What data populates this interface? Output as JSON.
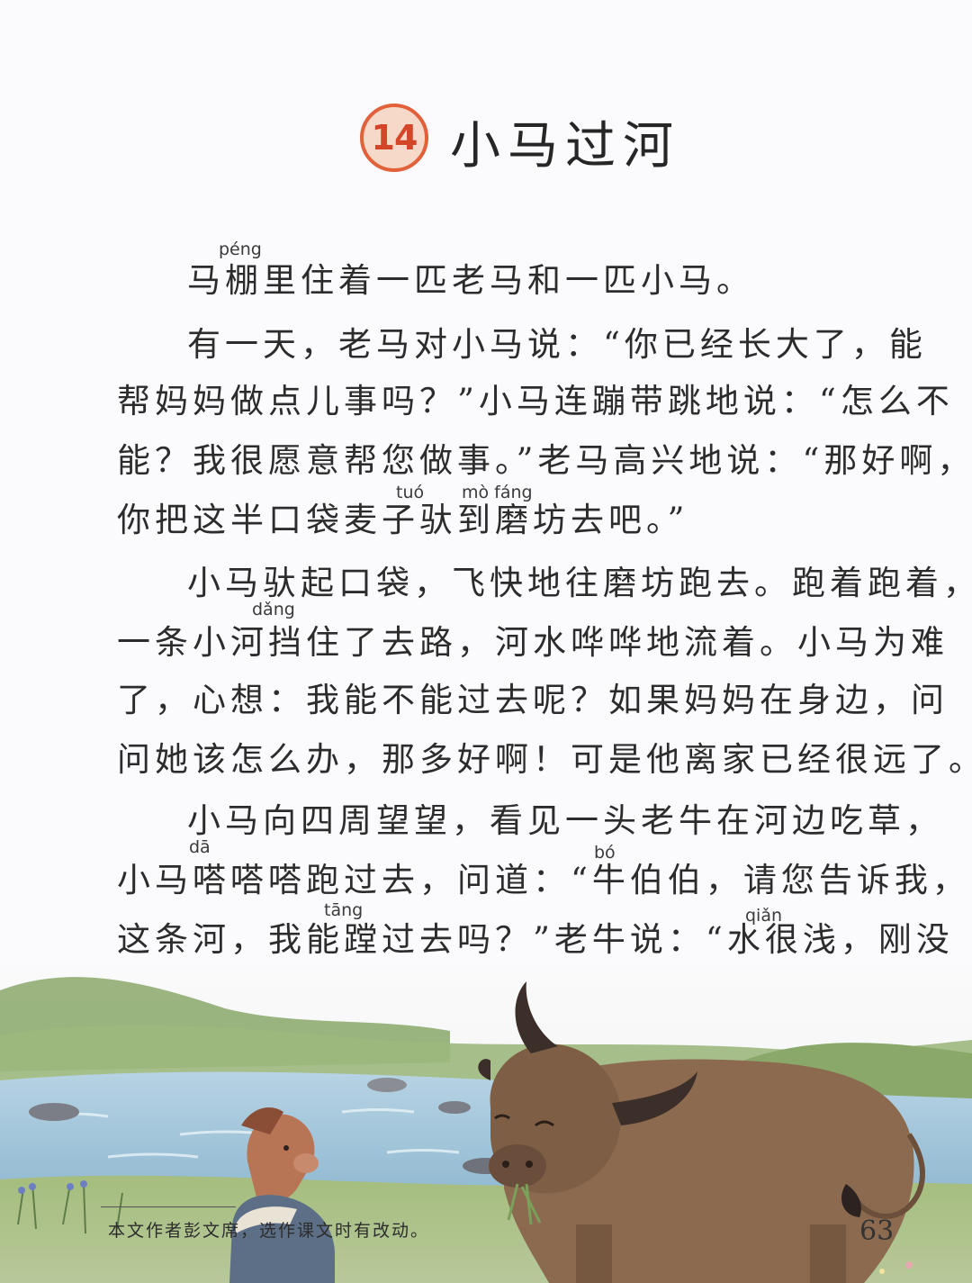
{
  "lesson": {
    "number": "14",
    "title": "小马过河"
  },
  "pinyin": {
    "peng": "péng",
    "tuo": "tuó",
    "mofang": "mò fáng",
    "dang": "dǎng",
    "da": "dā",
    "bo": "bó",
    "tang": "tāng",
    "qian": "qiǎn"
  },
  "paragraphs": {
    "p1_l1": "马棚里住着一匹老马和一匹小马。",
    "p2_l1": "有一天，老马对小马说：“你已经长大了，能",
    "p2_l2": "帮妈妈做点儿事吗？”小马连蹦带跳地说：“怎么不",
    "p2_l3": "能？我很愿意帮您做事。”老马高兴地说：“那好啊，",
    "p2_l4": "你把这半口袋麦子驮到磨坊去吧。”",
    "p3_l1": "小马驮起口袋，飞快地往磨坊跑去。跑着跑着，",
    "p3_l2": "一条小河挡住了去路，河水哗哗地流着。小马为难",
    "p3_l3": "了，心想：我能不能过去呢？如果妈妈在身边，问",
    "p3_l4": "问她该怎么办，那多好啊！可是他离家已经很远了。",
    "p4_l1": "小马向四周望望，看见一头老牛在河边吃草，",
    "p4_l2": "小马嗒嗒嗒跑过去，问道：“牛伯伯，请您告诉我，",
    "p4_l3": "这条河，我能蹚过去吗？”老牛说：“水很浅，刚没"
  },
  "footer": {
    "note": "本文作者彭文席，选作课文时有改动。",
    "page_number": "63"
  },
  "colors": {
    "badge_ring": "#e2613a",
    "badge_fill": "#f6d9c9",
    "water": "#9fc4d9",
    "grass": "#8fae6a",
    "ox": "#8b6a4f",
    "pony": "#b87555"
  },
  "icons": {
    "illustration": "pony-and-ox-by-river"
  }
}
